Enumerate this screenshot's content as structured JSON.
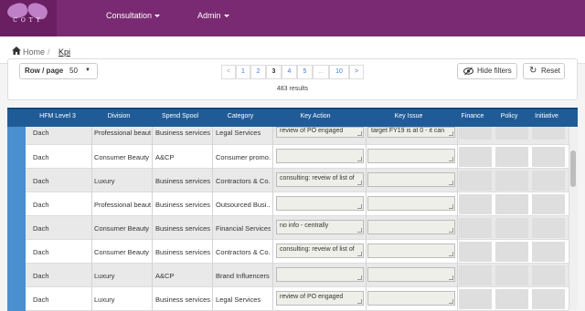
{
  "nav": {
    "logo_text": "COTY",
    "items": [
      {
        "label": "Consultation"
      },
      {
        "label": "Admin"
      }
    ]
  },
  "breadcrumb": {
    "home": "Home",
    "separator": "/",
    "current": "Kpi"
  },
  "controls": {
    "row_page_label": "Row / page",
    "row_page_value": "50",
    "hide_filters": "Hide filters",
    "reset": "Reset",
    "results": "483 results"
  },
  "pagination": [
    "<",
    "1",
    "2",
    "3",
    "4",
    "5",
    "...",
    "10",
    ">"
  ],
  "pagination_active": "3",
  "table": {
    "headers": [
      "HFM Level 3",
      "Division",
      "Spend Spool",
      "Category",
      "Key Action",
      "Key Issue",
      "Finance",
      "Policy",
      "Initiative"
    ],
    "rows": [
      {
        "hfm": "Dach",
        "division": "Professional beauty",
        "spend": "Business services",
        "category": "Legal Services",
        "key_action": "review of PO engaged",
        "key_issue": "target FY19 is at 0 - it can"
      },
      {
        "hfm": "Dach",
        "division": "Consumer Beauty",
        "spend": "A&CP",
        "category": "Consumer promo...",
        "key_action": "",
        "key_issue": ""
      },
      {
        "hfm": "Dach",
        "division": "Luxury",
        "spend": "Business services",
        "category": "Contractors & Co...",
        "key_action": "consulting: reveiw of list of",
        "key_issue": ""
      },
      {
        "hfm": "Dach",
        "division": "Professional beauty",
        "spend": "Business services",
        "category": "Outsourced Busi...",
        "key_action": "",
        "key_issue": ""
      },
      {
        "hfm": "Dach",
        "division": "Consumer Beauty",
        "spend": "Business services",
        "category": "Financial Services",
        "key_action": "no info - centrally",
        "key_issue": ""
      },
      {
        "hfm": "Dach",
        "division": "Consumer Beauty",
        "spend": "Business services",
        "category": "Contractors & Co...",
        "key_action": "consulting: reveiw of list of",
        "key_issue": ""
      },
      {
        "hfm": "Dach",
        "division": "Luxury",
        "spend": "A&CP",
        "category": "Brand Influencers",
        "key_action": "",
        "key_issue": ""
      },
      {
        "hfm": "Dach",
        "division": "Luxury",
        "spend": "Business services",
        "category": "Legal Services",
        "key_action": "review of PO engaged",
        "key_issue": ""
      }
    ]
  },
  "colors": {
    "topbar": "#7a2a72",
    "table_header": "#1f5c97",
    "row_handle": "#4a8fcf"
  }
}
